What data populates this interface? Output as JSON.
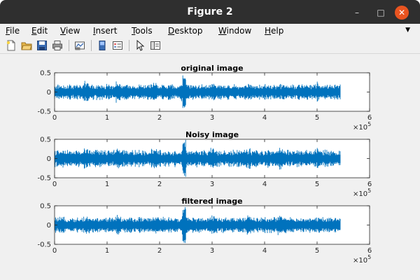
{
  "window": {
    "title": "Figure 2",
    "controls": {
      "minimize": "–",
      "maximize": "□",
      "close": "✕"
    }
  },
  "menubar": {
    "items": [
      {
        "key": "F",
        "rest": "ile"
      },
      {
        "key": "E",
        "rest": "dit"
      },
      {
        "key": "V",
        "rest": "iew"
      },
      {
        "key": "I",
        "rest": "nsert"
      },
      {
        "key": "T",
        "rest": "ools"
      },
      {
        "key": "D",
        "rest": "esktop"
      },
      {
        "key": "W",
        "rest": "indow"
      },
      {
        "key": "H",
        "rest": "elp"
      }
    ],
    "overflow_icon": "chevron-down-icon"
  },
  "toolbar": {
    "buttons": [
      "new-figure-icon",
      "open-file-icon",
      "save-icon",
      "print-icon",
      "link-plot-icon",
      "insert-colorbar-icon",
      "insert-legend-icon",
      "select-pointer-icon",
      "property-inspector-icon"
    ]
  },
  "colors": {
    "signal": "#0072bd",
    "close": "#e95420",
    "titlebar": "#2f2f2f"
  },
  "chart_data": [
    {
      "type": "line",
      "title": "original image",
      "xlim": [
        0,
        6
      ],
      "ylim": [
        -0.5,
        0.5
      ],
      "x_exponent": "5",
      "xticks": [
        "0",
        "1",
        "2",
        "3",
        "4",
        "5",
        "6"
      ],
      "yticks": [
        "0.5",
        "0",
        "-0.5"
      ],
      "signal_end_x": 5.45,
      "amplitude_typical": 0.22,
      "amplitude_peak": 0.5,
      "peak_x": 2.47
    },
    {
      "type": "line",
      "title": "Noisy image",
      "xlim": [
        0,
        6
      ],
      "ylim": [
        -0.5,
        0.5
      ],
      "x_exponent": "5",
      "xticks": [
        "0",
        "1",
        "2",
        "3",
        "4",
        "5",
        "6"
      ],
      "yticks": [
        "0.5",
        "0",
        "-0.5"
      ],
      "signal_end_x": 5.45,
      "amplitude_typical": 0.24,
      "amplitude_peak": 0.5,
      "peak_x": 2.47
    },
    {
      "type": "line",
      "title": "filtered image",
      "xlim": [
        0,
        6
      ],
      "ylim": [
        -0.5,
        0.5
      ],
      "x_exponent": "5",
      "xticks": [
        "0",
        "1",
        "2",
        "3",
        "4",
        "5",
        "6"
      ],
      "yticks": [
        "0.5",
        "0",
        "-0.5"
      ],
      "signal_end_x": 5.45,
      "amplitude_typical": 0.22,
      "amplitude_peak": 0.5,
      "peak_x": 2.47
    }
  ]
}
